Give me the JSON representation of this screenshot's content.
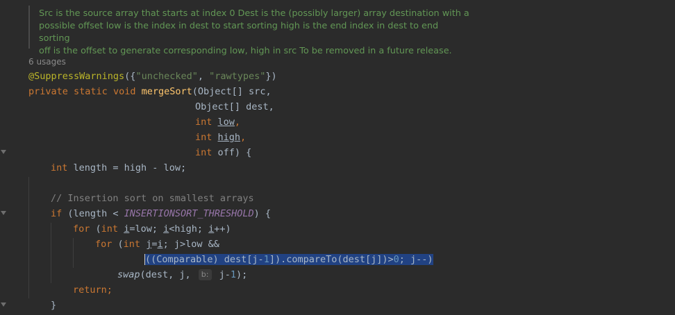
{
  "javadoc": {
    "line1": "Src is the source array that starts at index 0 Dest is the (possibly larger) array destination with a",
    "line2": "possible offset low is the index in dest to start sorting high is the end index in dest to end sorting",
    "line3": "off is the offset to generate corresponding low, high in src To be removed in a future release."
  },
  "usages": "6 usages",
  "code": {
    "annotation": "@SuppressWarnings",
    "ann_open": "({",
    "str_unchecked": "\"unchecked\"",
    "comma": ", ",
    "str_rawtypes": "\"rawtypes\"",
    "ann_close": "})",
    "kw_private": "private",
    "kw_static": "static",
    "kw_void": "void",
    "method": "mergeSort",
    "p_src": "(Object[] src,",
    "p_dest": "Object[] dest,",
    "kw_int": "int",
    "p_low": "low",
    "p_high": "high",
    "p_off": " off) {",
    "len_decl": " length = high - low;",
    "comment": "// Insertion sort on smallest arrays",
    "kw_if": "if",
    "if_cond": " (length < ",
    "threshold": "INSERTIONSORT_THRESHOLD",
    "if_end": ") {",
    "kw_for": "for",
    "for1_a": " (",
    "var_i": "i",
    "for1_b": "=low; ",
    "for1_c": "<high; ",
    "for1_d": "++)",
    "for2_a": " (",
    "var_j": "j",
    "for2_b": "=",
    "for2_c": "; j>low &&",
    "sel_a": "((Comparable) dest[j-",
    "one": "1",
    "sel_b": "]).compareTo(dest[j])>",
    "zero": "0",
    "sel_c": "; j--)",
    "swap": "swap",
    "swap_args": "(dest, j, ",
    "hint_b": "b:",
    "swap_end_a": " j-",
    "swap_end_b": ");",
    "kw_return": "return",
    "semicolon": ";",
    "close_brace": "}"
  }
}
